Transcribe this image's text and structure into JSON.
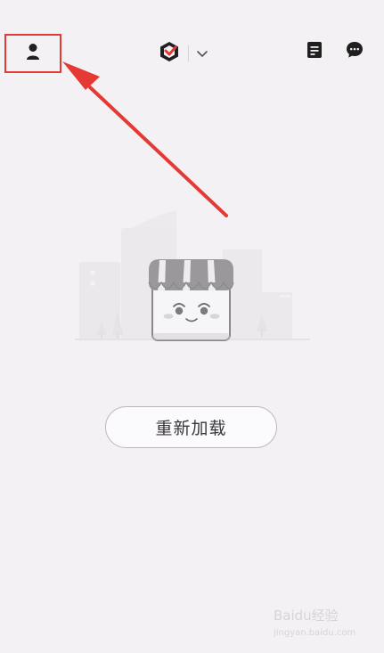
{
  "status_bar": {
    "left_fragment": "",
    "right_fragment": ""
  },
  "header": {
    "user_icon": "user-icon",
    "brand_icon": "brand-logo-icon",
    "brand_dropdown_icon": "chevron-down-icon",
    "notes_icon": "notes-icon",
    "message_icon": "chat-icon"
  },
  "content": {
    "empty_state_icon": "store-empty-illustration",
    "reload_label": "重新加载"
  },
  "annotation": {
    "color": "#e53935"
  },
  "watermark": {
    "text": "Baidu经验",
    "subtext": "jingyan.baidu.com"
  }
}
